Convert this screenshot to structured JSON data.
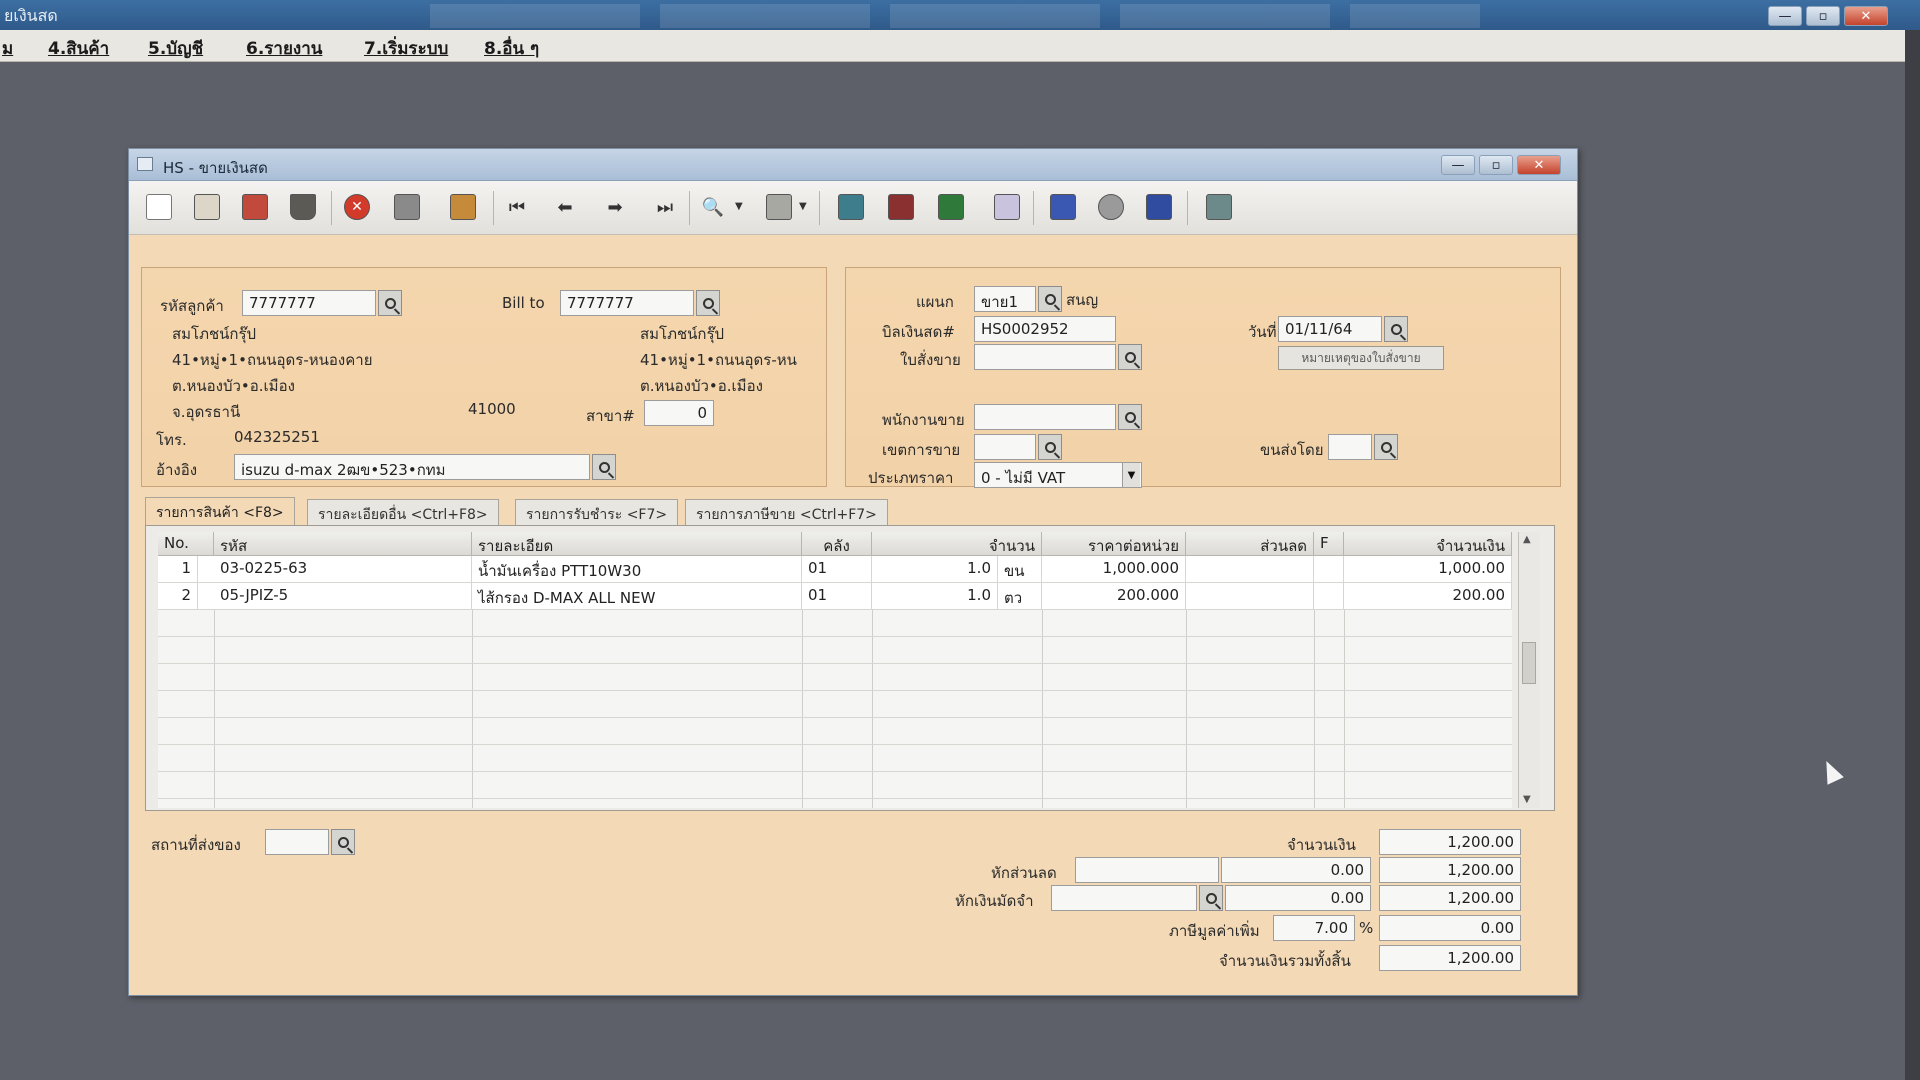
{
  "app": {
    "title": "ยเงินสด",
    "menu": [
      "ม",
      "4.สินค้า",
      "5.บัญชี",
      "6.รายงาน",
      "7.เริ่มระบบ",
      "8.อื่น ๆ"
    ]
  },
  "window": {
    "title": "HS - ขายเงินสด"
  },
  "customer": {
    "code_label": "รหัสลูกค้า",
    "code": "7777777",
    "name": "สมโภชน์กรุ๊ป",
    "address1": "41•หมู่•1•ถนนอุดร-หนองคาย",
    "address2": "ต.หนองบัว•อ.เมือง",
    "address3": "จ.อุดรธานี",
    "postcode": "41000",
    "phone_label": "โทร.",
    "phone": "042325251",
    "ref_label": "อ้างอิง",
    "ref": "isuzu d-max 2ฒข•523•กทม"
  },
  "bill_to": {
    "label": "Bill to",
    "code": "7777777",
    "name": "สมโภชน์กรุ๊ป",
    "address1": "41•หมู่•1•ถนนอุดร-หน",
    "address2": "ต.หนองบัว•อ.เมือง",
    "branch_label": "สาขา#",
    "branch": "0"
  },
  "doc": {
    "dept_label": "แผนก",
    "dept": "ขาย1",
    "dept_name": "สนญ",
    "bill_label": "บิลเงินสด#",
    "bill_no": "HS0002952",
    "date_label": "วันที่",
    "date": "01/11/64",
    "order_label": "ใบสั่งขาย",
    "order": "",
    "order_note_btn": "หมายเหตุของใบสั่งขาย",
    "salesman_label": "พนักงานขาย",
    "salesman": "",
    "area_label": "เขตการขาย",
    "area": "",
    "ship_by_label": "ขนส่งโดย",
    "ship_by": "",
    "price_type_label": "ประเภทราคา",
    "price_type": "0 - ไม่มี VAT"
  },
  "tabs": [
    "รายการสินค้า <F8>",
    "รายละเอียดอื่น <Ctrl+F8>",
    "รายการรับชำระ <F7>",
    "รายการภาษีขาย <Ctrl+F7>"
  ],
  "grid": {
    "headers": [
      "No.",
      "รหัส",
      "รายละเอียด",
      "คลัง",
      "จำนวน",
      "ราคาต่อหน่วย",
      "ส่วนลด",
      "F",
      "จำนวนเงิน"
    ],
    "rows": [
      {
        "no": "1",
        "code": "03-0225-63",
        "desc": "น้ำมันเครื่อง PTT10W30",
        "wh": "01",
        "qty": "1.0",
        "unit": "ขน",
        "price": "1,000.000",
        "disc": "",
        "f": "",
        "amount": "1,000.00"
      },
      {
        "no": "2",
        "code": "05-JPIZ-5",
        "desc": "ไส้กรอง D-MAX ALL NEW",
        "wh": "01",
        "qty": "1.0",
        "unit": "ตว",
        "price": "200.000",
        "disc": "",
        "f": "",
        "amount": "200.00"
      }
    ]
  },
  "footer": {
    "ship_place_label": "สถานที่ส่งของ",
    "ship_place": "",
    "amount_label": "จำนวนเงิน",
    "amount": "1,200.00",
    "discount_label": "หักส่วนลด",
    "discount_input": "",
    "discount_value": "0.00",
    "discount_after": "1,200.00",
    "deposit_label": "หักเงินมัดจำ",
    "deposit_input": "",
    "deposit_value": "0.00",
    "deposit_after": "1,200.00",
    "vat_label": "ภาษีมูลค่าเพิ่ม",
    "vat_rate": "7.00",
    "vat_pct": "%",
    "vat_amount": "0.00",
    "grand_label": "จำนวนเงินรวมทั้งสิ้น",
    "grand_total": "1,200.00"
  },
  "toolbar_icons": [
    "new-icon",
    "edit-icon",
    "copy-icon",
    "delete-icon",
    "cancel-icon",
    "save-icon",
    "approve-icon",
    "first-icon",
    "prev-icon",
    "next-icon",
    "last-icon",
    "find-icon",
    "print-icon",
    "screen1-icon",
    "screen2-icon",
    "calc-icon",
    "excel-icon",
    "post-ok-icon",
    "tools-icon",
    "ok-icon",
    "export-icon"
  ],
  "colors": {
    "form_bg": "#f3d9b6",
    "app_bg": "#5d6068",
    "titlebar": "#3d6fa3",
    "close": "#c4432c"
  }
}
